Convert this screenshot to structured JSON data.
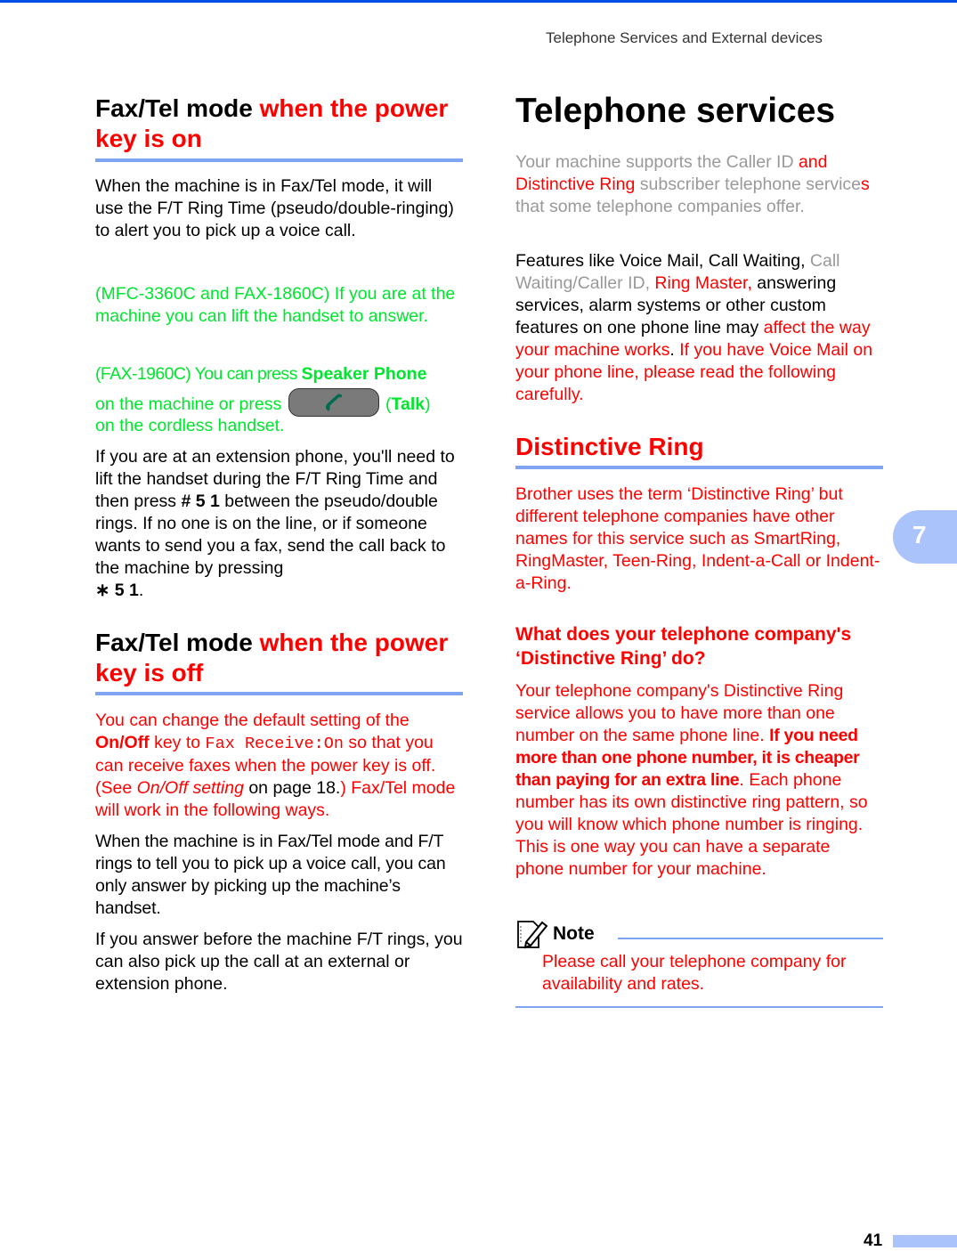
{
  "header": {
    "running_title": "Telephone Services and External devices"
  },
  "colors": {
    "accent_blue": "#0050e6",
    "rule_blue": "#7fa5f2",
    "tab_blue": "#aac3fb",
    "red": "#ff0000",
    "green": "#00e62e",
    "gray": "#999999"
  },
  "left": {
    "sec1": {
      "title_black": "Fax/Tel mode ",
      "title_red": "when the power key is on",
      "para1": "When the machine is in Fax/Tel mode, it will use the F/T Ring Time (pseudo/double-ringing) to alert you to pick up a voice call.",
      "para2": "(MFC-3360C and FAX-1860C) If you are at the machine you can lift the handset to answer.",
      "para3_a": "(FAX-1960C) You can press ",
      "para3_b": "Speaker Phone",
      "para3_c": " on the machine or press ",
      "para3_d": " (",
      "para3_e": "Talk",
      "para3_f": ")",
      "para3_g": "on the cordless handset.",
      "talk_key_icon": "phone-handset-icon",
      "para4_a": "If you are at an extension phone, you'll need to lift the handset during the F/T Ring Time and then press ",
      "para4_b": "# 5 1",
      "para4_c": " between the pseudo/double rings. If no one is on the line, or if someone wants to send you a fax, send the call back to the machine by pressing",
      "para4_d": "∗ 5 1",
      "para4_e": "."
    },
    "sec2": {
      "title_black": "Fax/Tel mode ",
      "title_red": "when the power key is off",
      "para1_a": "You can change the default setting of the ",
      "para1_b": "On/Off",
      "para1_c": " key to ",
      "para1_d": "Fax Receive:On",
      "para1_e": " so that you can receive faxes when the power key is off. (See ",
      "para1_f": "On/Off setting",
      "para1_g": " on page 18.",
      "para1_h": ") Fax/Tel mode will work in the following ways.",
      "para2": "When the machine is in Fax/Tel mode and F/T rings to tell you to pick up a voice call, you can only answer by picking up the machine’s handset.",
      "para3": "If you answer before the machine F/T rings, you can also pick up the call at an external or extension phone."
    }
  },
  "right": {
    "title": "Telephone services",
    "para1_a": "Your machine supports the Caller ID ",
    "para1_b": "and Distinctive Ring",
    "para1_c": " subscriber telephone service",
    "para1_d": "s",
    "para1_e": " that some telephone companies offer.",
    "para2_a": "Features like Voice Mail, Call Waiting, ",
    "para2_b": "Call Waiting/Caller ID, ",
    "para2_c": "Ring Master,",
    "para2_d": " answering services, alarm systems or other custom features on one phone line may ",
    "para2_e": "affect the way your machine works",
    "para2_f": ". ",
    "para2_g": "If you have Voice Mail on your phone line, please read the following carefully.",
    "distinctive": {
      "title": "Distinctive Ring",
      "para1": "Brother uses the term ‘Distinctive Ring’ but different telephone companies have other names for this service such as SmartRing, RingMaster, Teen-Ring, Indent-a-Call or Indent-a-Ring.",
      "subtitle": "What does your telephone company's ‘Distinctive Ring’ do?",
      "para2_a": "Your telephone company's Distinctive Ring service allows you to have more than one number on the same phone line. ",
      "para2_b": "If you need more than one phone number, it is cheaper than paying for an extra line",
      "para2_c": ". Each phone number has its own distinctive ring pattern, so you will know which phone number is ringing. This is one way you can have a separate phone number for your machine."
    },
    "note": {
      "label": "Note",
      "icon": "note-pencil-icon",
      "text": "Please call your telephone company for availability and rates."
    }
  },
  "chapter_tab": "7",
  "page_number": "41"
}
